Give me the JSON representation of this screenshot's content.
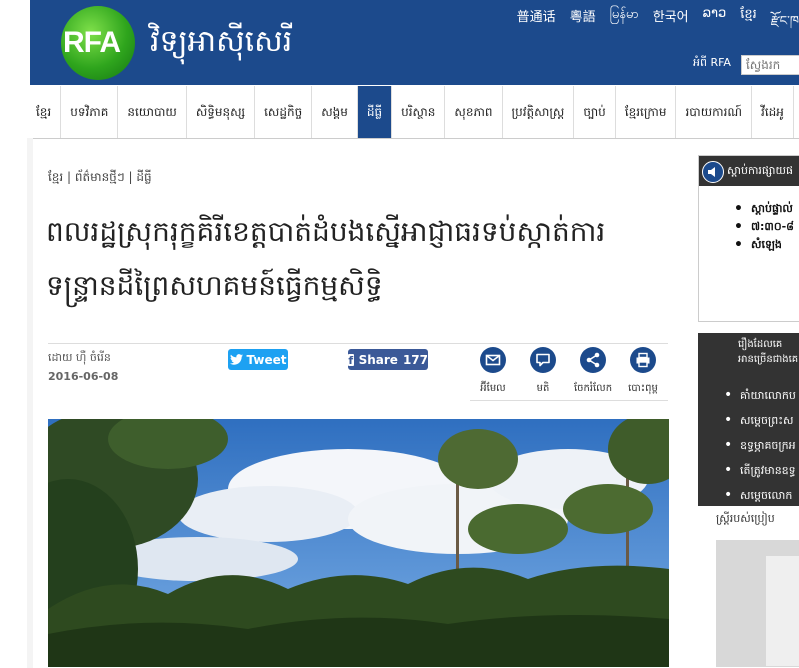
{
  "header": {
    "logo_text": "RFA",
    "site_name": "វិទ្យុអាស៊ីសេរី",
    "languages": [
      "普通话",
      "粵語",
      "မြန်မာ",
      "한국어",
      "ລາວ",
      "ខ្មែរ",
      "རྫོང་ཁ"
    ],
    "about_link": "អំពី RFA",
    "search_placeholder": "ស្វែងរក"
  },
  "nav": {
    "items": [
      "ខ្មែរ",
      "បទវិភាគ",
      "នយោបាយ",
      "សិទ្ធិមនុស្ស",
      "សេដ្ឋកិច្ច",
      "សង្គម",
      "ដីធ្លី",
      "បរិស្ថាន",
      "សុខភាព",
      "ប្រវត្តិសាស្ត្រ",
      "ច្បាប់",
      "ខ្មែរក្រោម",
      "របាយការណ៍",
      "វីដេអូ"
    ],
    "active_index": 6
  },
  "article": {
    "breadcrumb": "ខ្មែរ | ព័ត៌មានថ្មីៗ | ដីធ្លី",
    "title": "ពលរដ្ឋស្រុករុក្ខគិរីខេត្តបាត់ដំបងស្នើអាជ្ញាធរទប់ស្កាត់ការទន្ទ្រានដីព្រៃសហគមន៍ធ្វើកម្មសិទ្ធិ",
    "author": "ដោយ ហ៊ឺ ចំរើន",
    "date": "2016-06-08"
  },
  "share": {
    "tweet_label": "Tweet",
    "facebook_label": "Share",
    "facebook_count": "177"
  },
  "tools": [
    {
      "label": "អ៊ីមែល",
      "icon": "email-icon"
    },
    {
      "label": "មតិ",
      "icon": "comment-icon"
    },
    {
      "label": "ចែករំលែក",
      "icon": "share-icon"
    },
    {
      "label": "បោះពុម្ព",
      "icon": "print-icon"
    }
  ],
  "sidebar": {
    "listen_heading": "ស្ដាប់ការផ្សាយផ",
    "listen_items": [
      "ស្ដាប់ផ្ទាល់",
      "៧:៣០-៨",
      "សំឡេង"
    ],
    "dark_heading_line1": "រឿងដែលគេ",
    "dark_heading_line2": "អានច្រើនជាងគេ",
    "dark_items": [
      "គាំយាលោកប",
      "សម្ដេចព្រះស",
      "ឧទ្ធម្ភាគចក្រអ",
      "តើត្រូវមានឧទ្ធ",
      "សម្ដេចលោក"
    ],
    "section_label": "ស្ដ្រីរបស់ប្រៀប"
  },
  "colors": {
    "brand_blue": "#1c4a8c",
    "twitter": "#1da1f2",
    "facebook": "#3b5998",
    "sidebar_dark": "#333333"
  }
}
